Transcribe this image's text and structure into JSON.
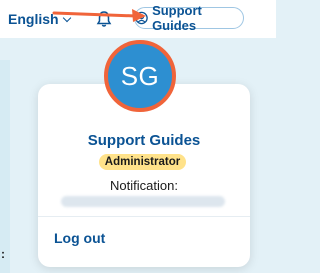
{
  "header": {
    "language": "English",
    "account_button": "Support Guides"
  },
  "profile": {
    "initials": "SG",
    "name": "Support Guides",
    "role": "Administrator",
    "notification_label": "Notification:",
    "logout": "Log out"
  },
  "colors": {
    "brand": "#0b5394",
    "avatar_bg": "#2d8fd1",
    "avatar_ring": "#f0643a",
    "badge_bg": "#ffe28a",
    "annotation_arrow": "#f0643a",
    "page_bg": "#e3f1f7"
  },
  "icons": [
    "chevron-down-icon",
    "bell-icon",
    "user-circle-icon"
  ]
}
